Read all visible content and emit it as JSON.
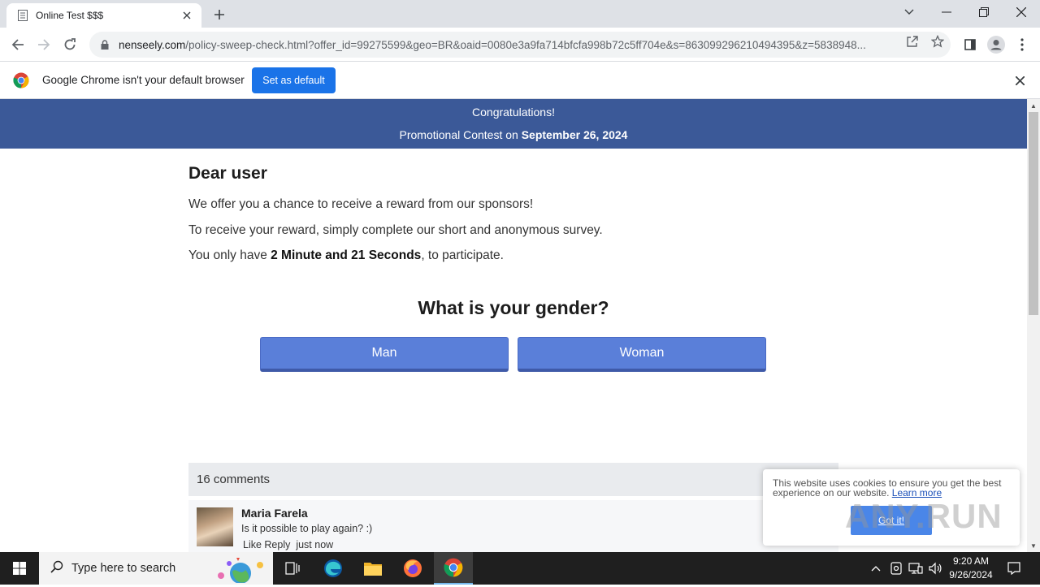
{
  "browser": {
    "tab_title": "Online Test $$$",
    "url_host": "nenseely.com",
    "url_path": "/policy-sweep-check.html?offer_id=99275599&geo=BR&oaid=0080e3a9fa714bfcfa998b72c5ff704e&s=863099296210494395&z=5838948...",
    "infobar_message": "Google Chrome isn't your default browser",
    "infobar_button": "Set as default"
  },
  "banner": {
    "line1": "Congratulations!",
    "line2_prefix": "Promotional Contest on ",
    "line2_date": "September 26, 2024"
  },
  "content": {
    "greeting": "Dear user",
    "p1": "We offer you a chance to receive a reward from our sponsors!",
    "p2": "To receive your reward, simply complete our short and anonymous survey.",
    "p3_prefix": "You only have ",
    "p3_time": "2 Minute and 21 Seconds",
    "p3_suffix": ", to participate.",
    "question": "What is your gender?",
    "answers": [
      "Man",
      "Woman"
    ]
  },
  "comments": {
    "count_label": "16 comments",
    "items": [
      {
        "name": "Maria Farela",
        "text": "Is it possible to play again? :)",
        "actions": "Like Reply",
        "time": "just now"
      }
    ]
  },
  "cookie": {
    "text": "This website uses cookies to ensure you get the best experience on our website.",
    "link": "Learn more",
    "button": "Got it!"
  },
  "watermark": "ANY.RUN",
  "taskbar": {
    "search_placeholder": "Type here to search",
    "time": "9:20 AM",
    "date": "9/26/2024"
  },
  "colors": {
    "banner": "#3b5998",
    "answer_button": "#5a7fd9",
    "chrome_blue": "#1a73e8"
  }
}
